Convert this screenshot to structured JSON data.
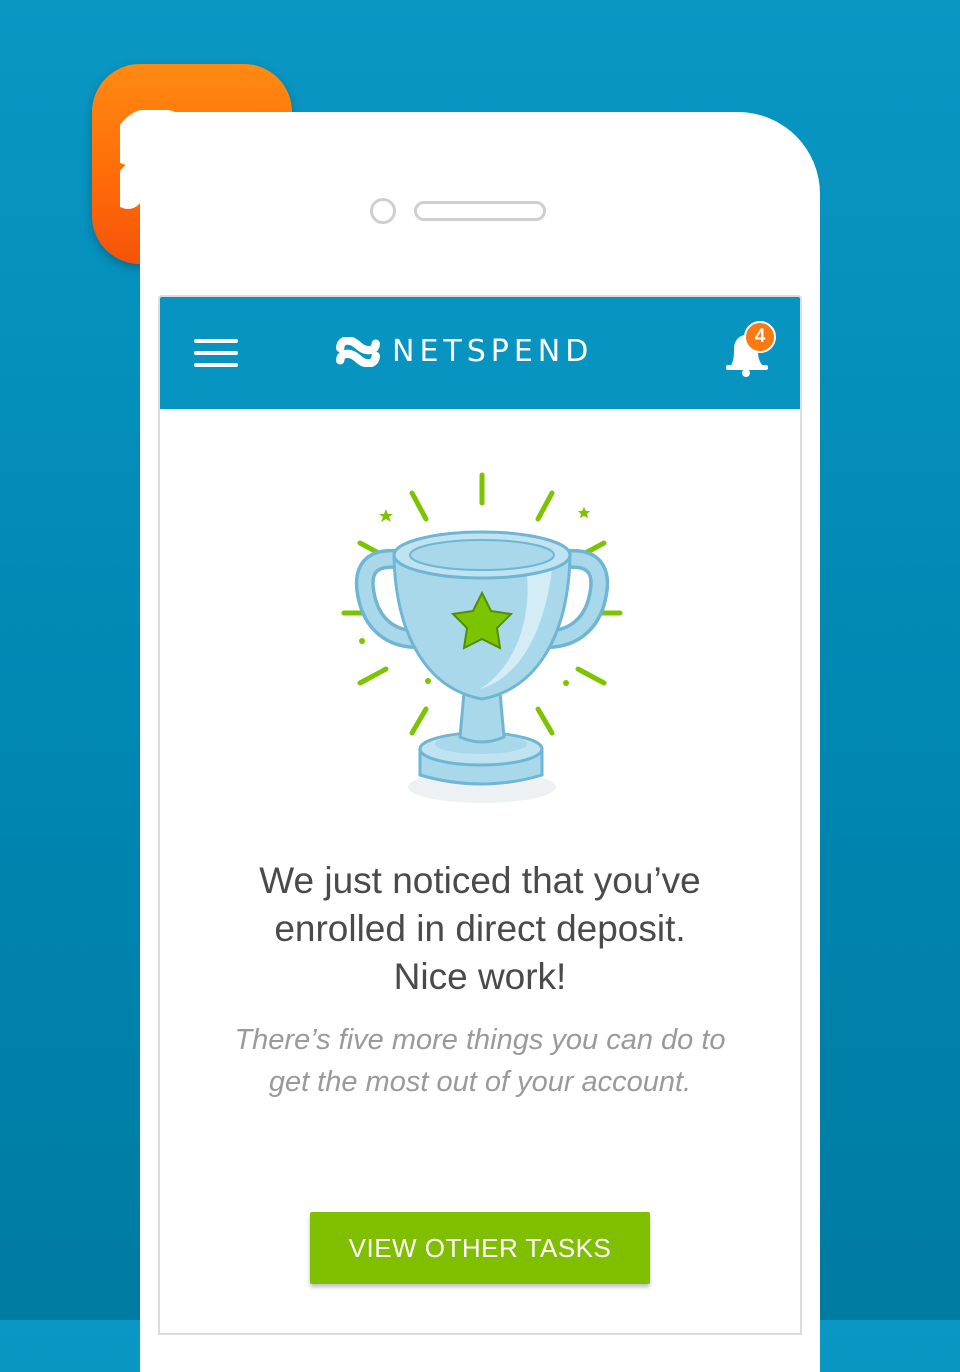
{
  "brand": {
    "name": "NETSPEND",
    "icon": "netspend-logo-icon"
  },
  "header": {
    "menu_icon": "hamburger-menu-icon",
    "notification_icon": "bell-icon",
    "notification_count": "4"
  },
  "content": {
    "illustration": "trophy-icon",
    "headline_lines": [
      "We just noticed that you’ve",
      "enrolled in direct deposit.",
      "Nice work!"
    ],
    "subtext_lines": [
      "There’s five more things you can do to",
      "get the most out of your account."
    ],
    "cta_label": "VIEW OTHER TASKS"
  },
  "colors": {
    "background": "#0a97c4",
    "header": "#0894c1",
    "accent_orange": "#ff7a0e",
    "cta_green": "#80bf00",
    "trophy_blue": "#a9d8ea",
    "sparkle_green": "#7cc400"
  }
}
